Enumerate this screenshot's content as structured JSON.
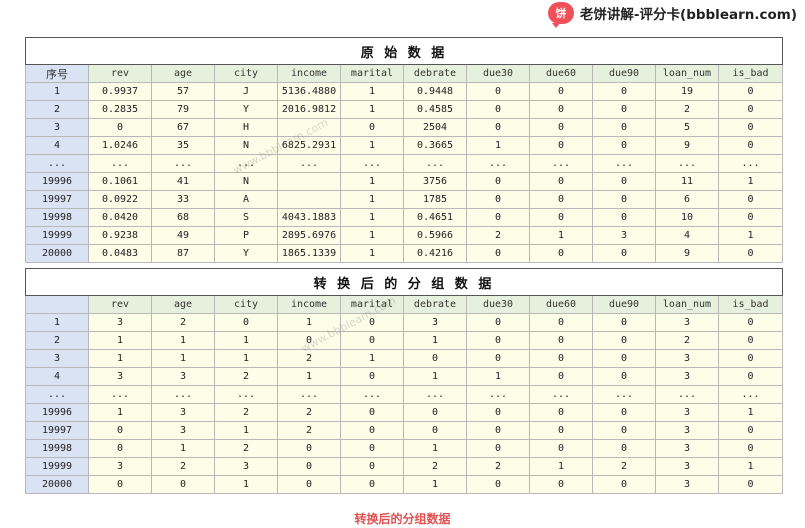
{
  "logo": {
    "badge": "饼",
    "text": "老饼讲解-评分卡(bbblearn.com)"
  },
  "watermark": "www.bbblearn.com",
  "table1": {
    "title": "原 始 数 据",
    "headers": [
      "序号",
      "rev",
      "age",
      "city",
      "income",
      "marital",
      "debrate",
      "due30",
      "due60",
      "due90",
      "loan_num",
      "is_bad"
    ],
    "rows": [
      [
        "1",
        "0.9937",
        "57",
        "J",
        "5136.4880",
        "1",
        "0.9448",
        "0",
        "0",
        "0",
        "19",
        "0"
      ],
      [
        "2",
        "0.2835",
        "79",
        "Y",
        "2016.9812",
        "1",
        "0.4585",
        "0",
        "0",
        "0",
        "2",
        "0"
      ],
      [
        "3",
        "0",
        "67",
        "H",
        "",
        "0",
        "2504",
        "0",
        "0",
        "0",
        "5",
        "0"
      ],
      [
        "4",
        "1.0246",
        "35",
        "N",
        "6825.2931",
        "1",
        "0.3665",
        "1",
        "0",
        "0",
        "9",
        "0"
      ],
      [
        "...",
        "...",
        "...",
        "...",
        "...",
        "...",
        "...",
        "...",
        "...",
        "...",
        "...",
        "..."
      ],
      [
        "19996",
        "0.1061",
        "41",
        "N",
        "",
        "1",
        "3756",
        "0",
        "0",
        "0",
        "11",
        "1"
      ],
      [
        "19997",
        "0.0922",
        "33",
        "A",
        "",
        "1",
        "1785",
        "0",
        "0",
        "0",
        "6",
        "0"
      ],
      [
        "19998",
        "0.0420",
        "68",
        "S",
        "4043.1883",
        "1",
        "0.4651",
        "0",
        "0",
        "0",
        "10",
        "0"
      ],
      [
        "19999",
        "0.9238",
        "49",
        "P",
        "2895.6976",
        "1",
        "0.5966",
        "2",
        "1",
        "3",
        "4",
        "1"
      ],
      [
        "20000",
        "0.0483",
        "87",
        "Y",
        "1865.1339",
        "1",
        "0.4216",
        "0",
        "0",
        "0",
        "9",
        "0"
      ]
    ]
  },
  "table2": {
    "title": "转 换 后 的 分 组 数 据",
    "headers": [
      "",
      "rev",
      "age",
      "city",
      "income",
      "marital",
      "debrate",
      "due30",
      "due60",
      "due90",
      "loan_num",
      "is_bad"
    ],
    "rows": [
      [
        "1",
        "3",
        "2",
        "0",
        "1",
        "0",
        "3",
        "0",
        "0",
        "0",
        "3",
        "0"
      ],
      [
        "2",
        "1",
        "1",
        "1",
        "0",
        "0",
        "1",
        "0",
        "0",
        "0",
        "2",
        "0"
      ],
      [
        "3",
        "1",
        "1",
        "1",
        "2",
        "1",
        "0",
        "0",
        "0",
        "0",
        "3",
        "0"
      ],
      [
        "4",
        "3",
        "3",
        "2",
        "1",
        "0",
        "1",
        "1",
        "0",
        "0",
        "3",
        "0"
      ],
      [
        "...",
        "...",
        "...",
        "...",
        "...",
        "...",
        "...",
        "...",
        "...",
        "...",
        "...",
        "..."
      ],
      [
        "19996",
        "1",
        "3",
        "2",
        "2",
        "0",
        "0",
        "0",
        "0",
        "0",
        "3",
        "1"
      ],
      [
        "19997",
        "0",
        "3",
        "1",
        "2",
        "0",
        "0",
        "0",
        "0",
        "0",
        "3",
        "0"
      ],
      [
        "19998",
        "0",
        "1",
        "2",
        "0",
        "0",
        "1",
        "0",
        "0",
        "0",
        "3",
        "0"
      ],
      [
        "19999",
        "3",
        "2",
        "3",
        "0",
        "0",
        "2",
        "2",
        "1",
        "2",
        "3",
        "1"
      ],
      [
        "20000",
        "0",
        "0",
        "1",
        "0",
        "0",
        "1",
        "0",
        "0",
        "0",
        "3",
        "0"
      ]
    ]
  },
  "caption": "转换后的分组数据"
}
